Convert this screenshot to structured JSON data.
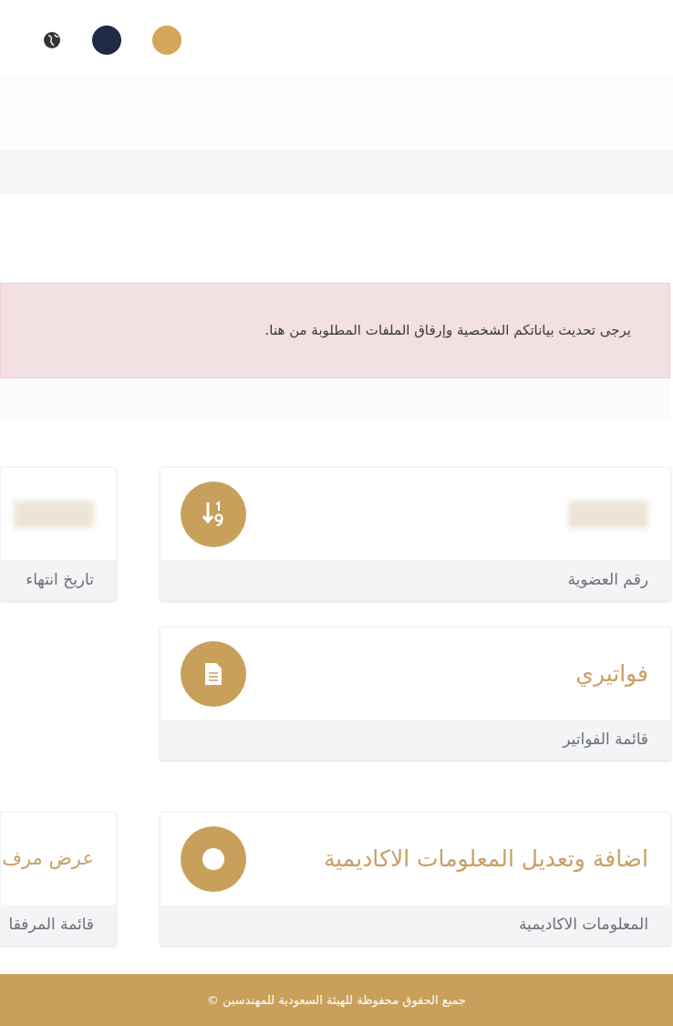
{
  "header": {
    "theme_swatches": [
      {
        "color": "#1f2a44"
      },
      {
        "color": "#d4a55a"
      }
    ]
  },
  "alert": {
    "text": "يرجى تحديث بياناتكم الشخصية وإرفاق الملفات المطلوبة من هنا."
  },
  "card_rows": [
    {
      "cards": [
        {
          "kind": "redacted",
          "footer": "رقم العضوية"
        },
        {
          "kind": "redacted",
          "footer": "تاريخ انتهاء"
        }
      ]
    },
    {
      "cards": [
        {
          "kind": "title",
          "title": "فواتيري",
          "footer": "قائمة الفواتير"
        }
      ]
    },
    {
      "cards": [
        {
          "kind": "title",
          "title": "اضافة وتعديل المعلومات الاكاديمية",
          "footer": "المعلومات الاكاديمية"
        },
        {
          "kind": "title",
          "title": "عرض مرف",
          "footer": "قائمة المرفقا"
        }
      ]
    }
  ],
  "footer": {
    "text": "جميع الحقوق محفوظة للهيئة السعودية للمهندسين ©"
  }
}
